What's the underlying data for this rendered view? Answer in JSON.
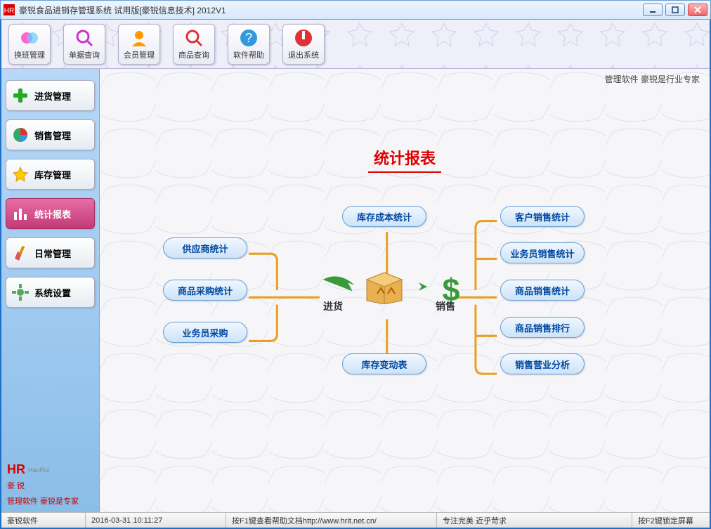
{
  "title": "豪锐食品进销存管理系统 试用版[豪锐信息技术] 2012V1",
  "toolbar": [
    {
      "label": "换班管理",
      "icon": "swap"
    },
    {
      "label": "单据查询",
      "icon": "search-doc"
    },
    {
      "label": "会员管理",
      "icon": "member"
    },
    {
      "label": "商品查询",
      "icon": "search-goods"
    },
    {
      "label": "软件帮助",
      "icon": "help"
    },
    {
      "label": "退出系统",
      "icon": "exit"
    }
  ],
  "sidebar": [
    {
      "label": "进货管理",
      "icon": "plus",
      "active": false
    },
    {
      "label": "销售管理",
      "icon": "pie",
      "active": false
    },
    {
      "label": "库存管理",
      "icon": "star",
      "active": false
    },
    {
      "label": "统计报表",
      "icon": "bars",
      "active": true
    },
    {
      "label": "日常管理",
      "icon": "brush",
      "active": false
    },
    {
      "label": "系统设置",
      "icon": "gear",
      "active": false
    }
  ],
  "brand": {
    "logo_en": "HR",
    "logo_sub": "HaoRui",
    "logo_cn": "豪 锐",
    "slogan": "管理软件  豪锐是专家"
  },
  "corner_text": "管理软件  豪锐是行业专家",
  "diagram": {
    "title": "统计报表",
    "left_nodes": [
      "供应商统计",
      "商品采购统计",
      "业务员采购"
    ],
    "top_node": "库存成本统计",
    "bottom_node": "库存变动表",
    "right_nodes": [
      "客户销售统计",
      "业务员销售统计",
      "商品销售统计",
      "商品销售排行",
      "销售营业分析"
    ],
    "in_label": "进货",
    "out_label": "销售"
  },
  "statusbar": {
    "company": "豪锐软件",
    "datetime": "2016-03-31 10:11:27",
    "help": "按F1键查看帮助文档http://www.hrit.net.cn/",
    "motto": "专注完美 近乎苛求",
    "lock": "按F2键锁定屏幕"
  }
}
